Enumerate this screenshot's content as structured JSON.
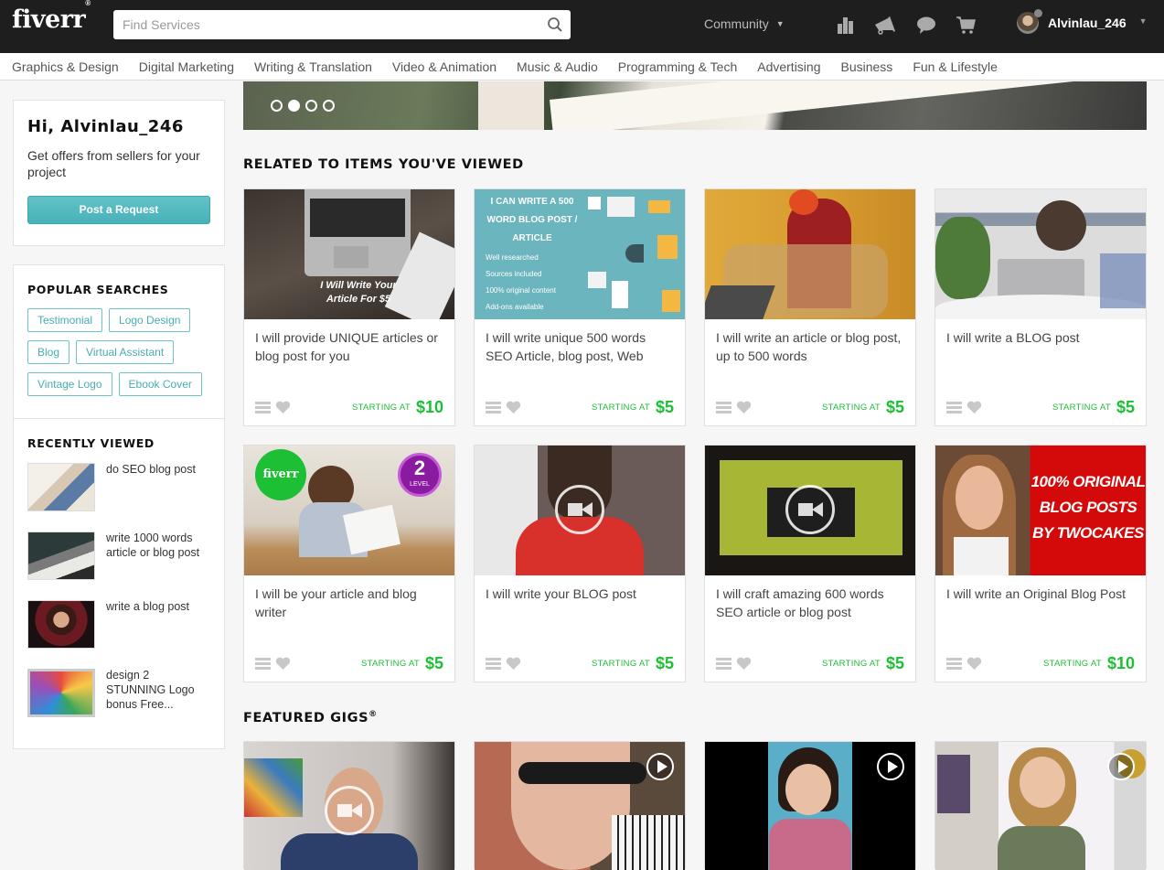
{
  "header": {
    "logo": "fiverr",
    "logo_mark": "®",
    "search_placeholder": "Find Services",
    "community_label": "Community",
    "icons": [
      "analytics-icon",
      "megaphone-icon",
      "chat-icon",
      "cart-icon"
    ],
    "username": "Alvinlau_246"
  },
  "categories": [
    "Graphics & Design",
    "Digital Marketing",
    "Writing & Translation",
    "Video & Animation",
    "Music & Audio",
    "Programming & Tech",
    "Advertising",
    "Business",
    "Fun & Lifestyle"
  ],
  "sidebar": {
    "greeting": "Hi, Alvinlau_246",
    "prompt": "Get offers from sellers for your project",
    "request_button": "Post a Request",
    "popular_title": "POPULAR SEARCHES",
    "popular_tags": [
      "Testimonial",
      "Logo Design",
      "Blog",
      "Virtual Assistant",
      "Vintage Logo",
      "Ebook Cover"
    ],
    "recent_title": "RECENTLY VIEWED",
    "recent_items": [
      {
        "title": "do SEO blog post"
      },
      {
        "title": "write 1000 words article or blog post"
      },
      {
        "title": "write a blog post"
      },
      {
        "title": "design 2 STUNNING Logo bonus Free..."
      }
    ]
  },
  "hero": {
    "slides": 4,
    "active_slide": 2
  },
  "related": {
    "title": "RELATED TO ITEMS YOU'VE VIEWED",
    "starting_label": "STARTING AT",
    "gigs": [
      {
        "title": "I will provide UNIQUE articles or blog post for you",
        "price": "$10",
        "image_text": "I Will Write Your Article For $5"
      },
      {
        "title": "I will write unique 500 words SEO Article, blog post, Web",
        "price": "$5",
        "image_text": "I CAN WRITE A 500 WORD BLOG POST / ARTICLE",
        "image_bullets": [
          "Well researched",
          "Sources included",
          "100% original content",
          "Add-ons available"
        ]
      },
      {
        "title": "I will write an article or blog post, up to 500 words",
        "price": "$5"
      },
      {
        "title": "I will write a BLOG post",
        "price": "$5"
      },
      {
        "title": "I will be your article and blog writer",
        "price": "$5",
        "image_badge": "fiverr",
        "image_level": "2",
        "image_level_label": "LEVEL"
      },
      {
        "title": "I will write your BLOG post",
        "price": "$5",
        "video": true
      },
      {
        "title": "I will craft amazing 600 words SEO article or blog post",
        "price": "$5",
        "video": true
      },
      {
        "title": "I will write an Original Blog Post",
        "price": "$10",
        "image_text": "100% ORIGINAL BLOG POSTS BY TWOCAKES"
      }
    ]
  },
  "featured": {
    "title": "FEATURED GIGS",
    "mark": "®"
  }
}
